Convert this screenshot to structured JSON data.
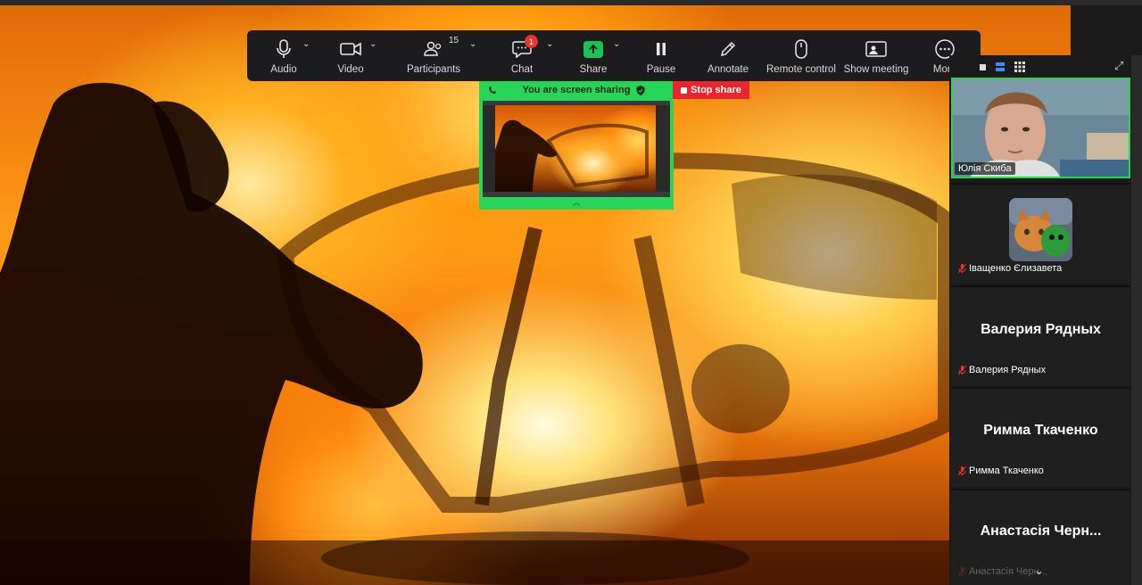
{
  "toolbar": {
    "audio": "Audio",
    "video": "Video",
    "participants": "Participants",
    "participants_count": "15",
    "chat": "Chat",
    "chat_badge": "1",
    "share": "Share",
    "pause": "Pause",
    "annotate": "Annotate",
    "remote_control": "Remote control",
    "show_meeting": "Show meeting",
    "more": "More"
  },
  "sharing": {
    "banner": "You are screen sharing",
    "stop": "Stop share"
  },
  "panel": {
    "participants": [
      {
        "name": "Юлія Скиба",
        "video": true
      },
      {
        "name": "Іващенко Єлизавета",
        "avatar": "cat-photo"
      },
      {
        "display": "Валерия Рядных",
        "name": "Валерия Рядных"
      },
      {
        "display": "Римма Ткаченко",
        "name": "Римма Ткаченко"
      },
      {
        "display": "Анастасія Черн...",
        "name": "Анастасія Черн..."
      }
    ]
  },
  "colors": {
    "share_green": "#27d658",
    "stop_red": "#e8262b",
    "toolbar_bg": "#1c1c1e"
  }
}
